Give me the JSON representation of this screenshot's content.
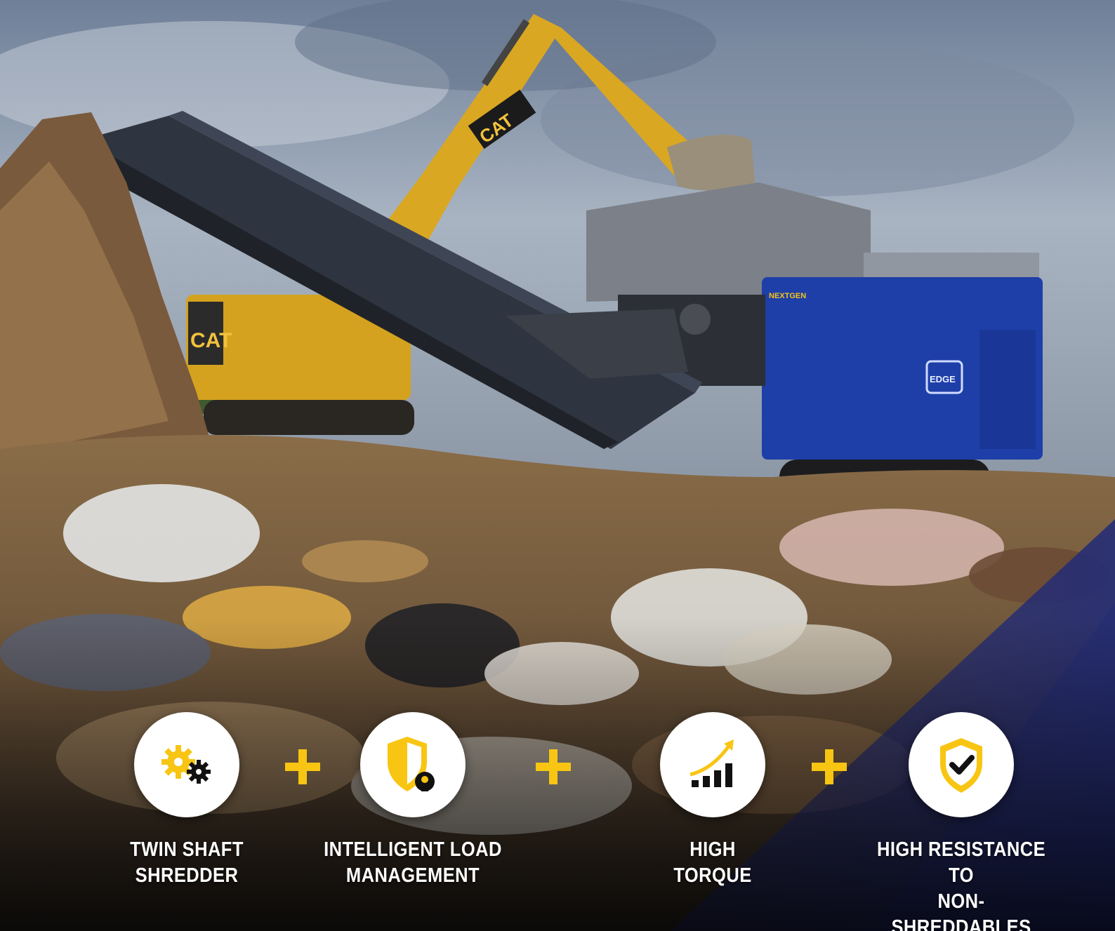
{
  "scene": {
    "brand_cat": "CAT",
    "machine_badge": "EDGE",
    "machine_model": "NEXTGEN"
  },
  "features": [
    {
      "icon": "twin-shaft-gears-icon",
      "line1": "TWIN SHAFT",
      "line2": "SHREDDER"
    },
    {
      "icon": "shield-brain-icon",
      "line1": "INTELLIGENT LOAD",
      "line2": "MANAGEMENT"
    },
    {
      "icon": "rising-bars-arrow-icon",
      "line1": "HIGH",
      "line2": "TORQUE"
    },
    {
      "icon": "shield-check-icon",
      "line1": "HIGH RESISTANCE TO",
      "line2": "NON-SHREDDABLES"
    }
  ],
  "colors": {
    "accent_yellow": "#F8C513",
    "overlay_navy": "#1F2A78",
    "machine_blue": "#1E3FA8",
    "icon_dark": "#111111"
  }
}
